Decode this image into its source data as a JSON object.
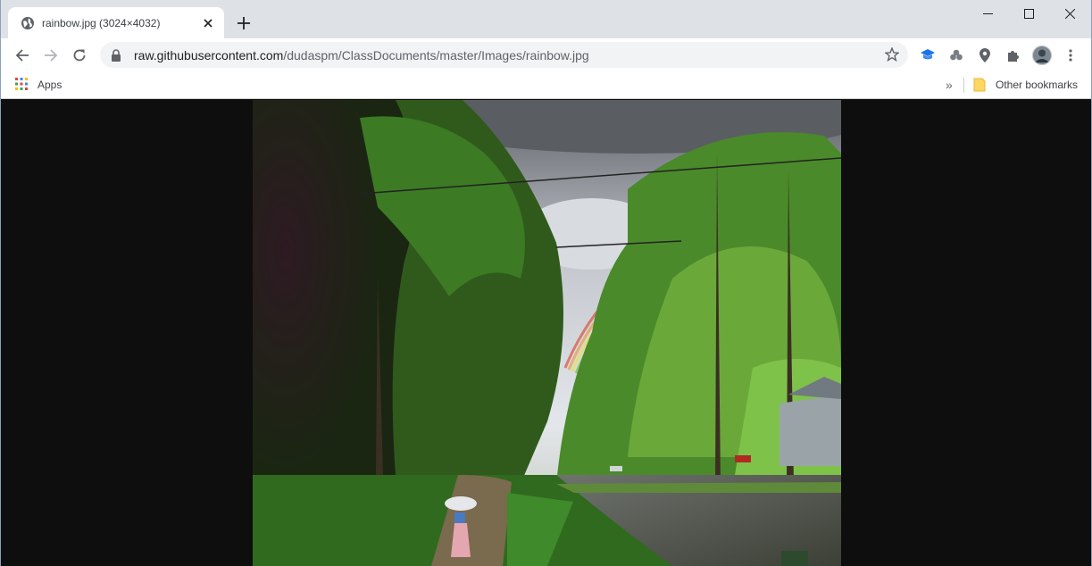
{
  "tab": {
    "title": "rainbow.jpg (3024×4032)",
    "favicon": "globe-icon"
  },
  "window_controls": [
    "minimize-icon",
    "maximize-icon",
    "close-icon"
  ],
  "toolbar": {
    "url_host": "raw.githubusercontent.com",
    "url_path": "/dudaspm/ClassDocuments/master/Images/rainbow.jpg",
    "extensions": [
      "graduation-cap-icon",
      "clover-icon",
      "map-pin-icon",
      "puzzle-icon",
      "avatar"
    ]
  },
  "bookmarks": {
    "apps_label": "Apps",
    "overflow": "»",
    "other_label": "Other bookmarks"
  },
  "content": {
    "image_alt": "rainbow.jpg",
    "background": "#0e0e0e"
  }
}
